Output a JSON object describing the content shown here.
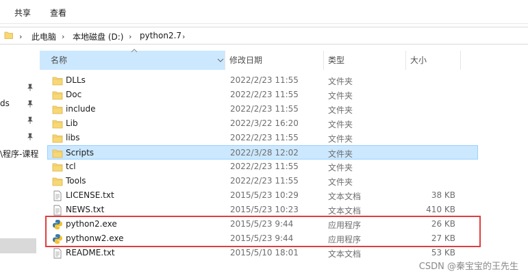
{
  "ribbon": {
    "tabs": [
      {
        "label": "共享"
      },
      {
        "label": "查看"
      }
    ]
  },
  "address": {
    "crumbs": [
      {
        "label": "此电脑"
      },
      {
        "label": "本地磁盘 (D:)"
      },
      {
        "label": "python2.7"
      }
    ]
  },
  "nav": {
    "items": [
      {
        "label": "ds"
      },
      {
        "label": "\\程序-课程"
      }
    ]
  },
  "columns": {
    "name": "名称",
    "date": "修改日期",
    "type": "类型",
    "size": "大小"
  },
  "files": [
    {
      "name": "DLLs",
      "date": "2022/2/23 11:55",
      "type": "文件夹",
      "size": "",
      "icon": "folder-icon"
    },
    {
      "name": "Doc",
      "date": "2022/2/23 11:55",
      "type": "文件夹",
      "size": "",
      "icon": "folder-icon"
    },
    {
      "name": "include",
      "date": "2022/2/23 11:55",
      "type": "文件夹",
      "size": "",
      "icon": "folder-icon"
    },
    {
      "name": "Lib",
      "date": "2022/3/22 16:20",
      "type": "文件夹",
      "size": "",
      "icon": "folder-icon"
    },
    {
      "name": "libs",
      "date": "2022/2/23 11:55",
      "type": "文件夹",
      "size": "",
      "icon": "folder-icon"
    },
    {
      "name": "Scripts",
      "date": "2022/3/28 12:02",
      "type": "文件夹",
      "size": "",
      "icon": "folder-icon",
      "selected": true
    },
    {
      "name": "tcl",
      "date": "2022/2/23 11:55",
      "type": "文件夹",
      "size": "",
      "icon": "folder-icon"
    },
    {
      "name": "Tools",
      "date": "2022/2/23 11:55",
      "type": "文件夹",
      "size": "",
      "icon": "folder-icon"
    },
    {
      "name": "LICENSE.txt",
      "date": "2015/5/23 10:29",
      "type": "文本文档",
      "size": "38 KB",
      "icon": "text-file-icon"
    },
    {
      "name": "NEWS.txt",
      "date": "2015/5/23 10:23",
      "type": "文本文档",
      "size": "410 KB",
      "icon": "text-file-icon"
    },
    {
      "name": "python2.exe",
      "date": "2015/5/23 9:44",
      "type": "应用程序",
      "size": "26 KB",
      "icon": "python-icon"
    },
    {
      "name": "pythonw2.exe",
      "date": "2015/5/23 9:44",
      "type": "应用程序",
      "size": "27 KB",
      "icon": "python-icon"
    },
    {
      "name": "README.txt",
      "date": "2015/5/10 18:01",
      "type": "文本文档",
      "size": "53 KB",
      "icon": "text-file-icon"
    }
  ],
  "watermark": "CSDN @秦宝宝的王先生",
  "colors": {
    "selection": "#cce8ff",
    "selection_border": "#99d1ff",
    "highlight_box": "#e03c3c",
    "folder": "#f8d775"
  }
}
